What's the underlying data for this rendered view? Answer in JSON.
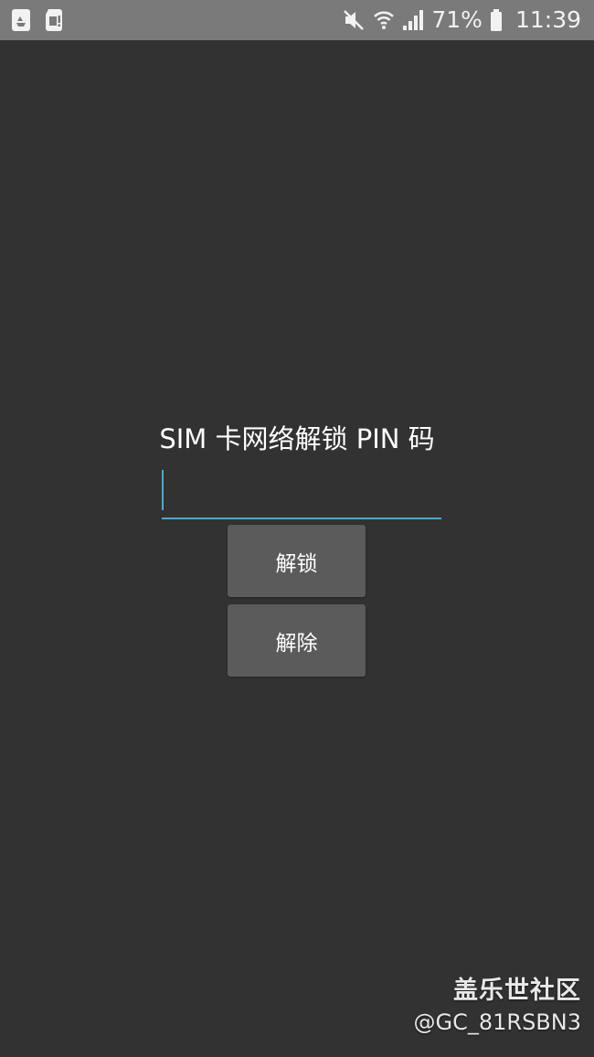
{
  "status_bar": {
    "left_icons": [
      "recycle-notification-icon",
      "sim-card-alert-icon"
    ],
    "right_icons": [
      "mute-icon",
      "wifi-icon",
      "cell-signal-icon",
      "battery-icon"
    ],
    "battery_percent": "71%",
    "time": "11:39"
  },
  "dialog": {
    "title": "SIM 卡网络解锁 PIN 码",
    "pin_input": {
      "value": "",
      "placeholder": ""
    },
    "unlock_label": "解锁",
    "dismiss_label": "解除"
  },
  "colors": {
    "background": "#323232",
    "status_bar": "#7a7a7a",
    "accent": "#4fa9c8",
    "button": "#5b5b5b"
  },
  "watermark": {
    "brand": "盖乐世社区",
    "user": "@GC_81RSBN3"
  }
}
